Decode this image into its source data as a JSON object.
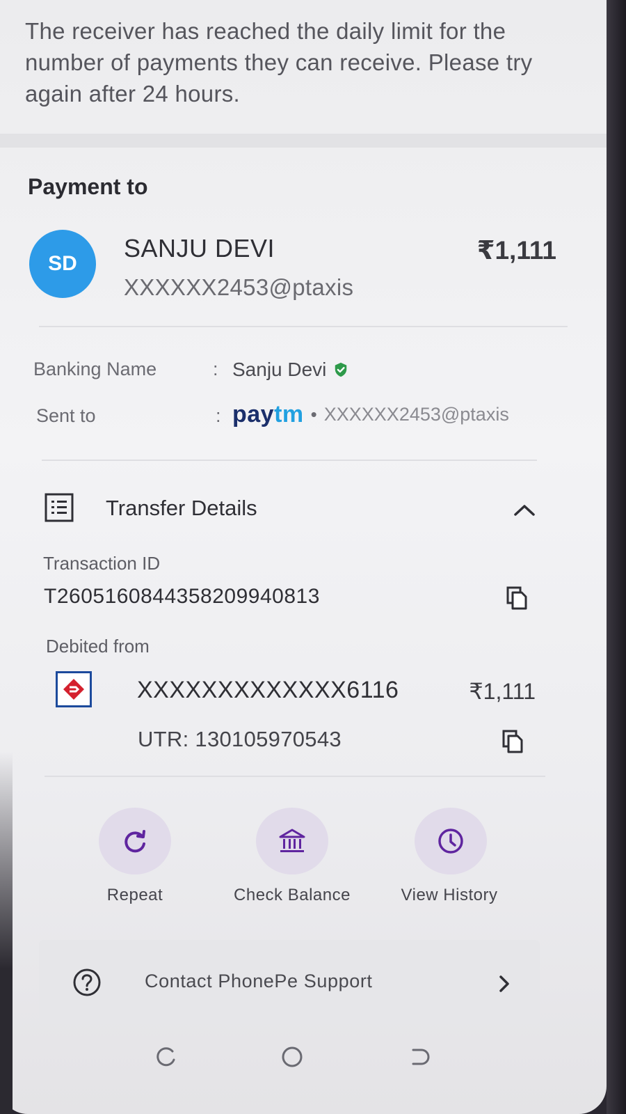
{
  "error_message": "The receiver has reached the daily limit for the number of payments they can receive. Please try again after 24 hours.",
  "payment": {
    "section_title": "Payment to",
    "avatar_initials": "SD",
    "payee_name": "SANJU DEVI",
    "payee_upi": "XXXXXX2453@ptaxis",
    "amount": "₹1,111"
  },
  "details": {
    "banking_name_label": "Banking Name",
    "banking_name_value": "Sanju Devi",
    "sent_to_label": "Sent to",
    "sent_to_app_pay": "pay",
    "sent_to_app_tm": "tm",
    "sent_to_separator": "•",
    "sent_to_upi": "XXXXXX2453@ptaxis",
    "colon": ":"
  },
  "transfer": {
    "title": "Transfer Details",
    "transaction_id_label": "Transaction ID",
    "transaction_id": "T2605160844358209940813",
    "debited_from_label": "Debited from",
    "account_number": "XXXXXXXXXXXXX6116",
    "account_amount": "₹1,111",
    "utr": "UTR: 130105970543"
  },
  "actions": [
    {
      "label": "Repeat",
      "icon": "repeat-icon"
    },
    {
      "label": "Check Balance",
      "icon": "bank-icon"
    },
    {
      "label": "View History",
      "icon": "clock-icon"
    }
  ],
  "support": {
    "label": "Contact PhonePe Support",
    "icon": "help-icon"
  },
  "colors": {
    "avatar": "#2d9be8",
    "accent_purple": "#5f259f",
    "verified_green": "#2e9a4a",
    "paytm_dark": "#1b2f6b",
    "paytm_light": "#21a0e0"
  }
}
